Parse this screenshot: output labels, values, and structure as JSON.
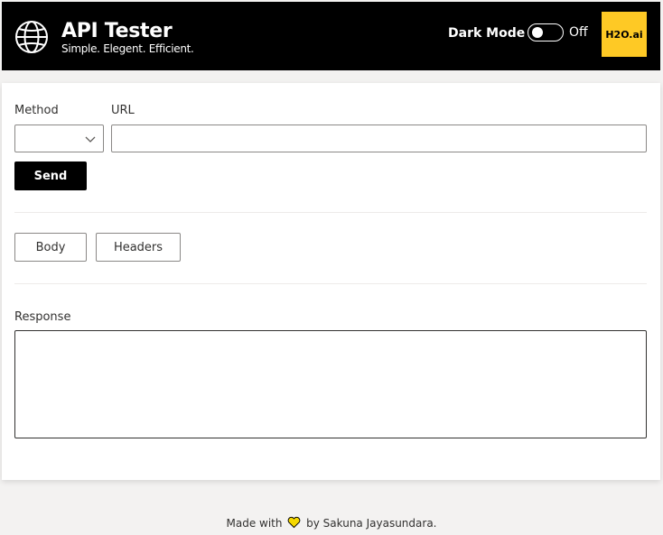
{
  "header": {
    "title": "API Tester",
    "subtitle": "Simple. Elegent. Efficient.",
    "dark_mode_label": "Dark Mode",
    "dark_mode_state": "Off",
    "logo_text": "H2O.ai",
    "logo_color": "#fec925"
  },
  "form": {
    "method_label": "Method",
    "method_value": "",
    "url_label": "URL",
    "url_value": "",
    "send_label": "Send"
  },
  "tabs": [
    {
      "label": "Body"
    },
    {
      "label": "Headers"
    }
  ],
  "response": {
    "label": "Response",
    "value": ""
  },
  "footer": {
    "prefix": "Made with",
    "suffix": "by Sakuna Jayasundara.",
    "heart_color": "#f5d800"
  },
  "icons": {
    "globe": "globe-icon",
    "chevron": "chevron-down-icon",
    "heart": "heart-icon"
  }
}
